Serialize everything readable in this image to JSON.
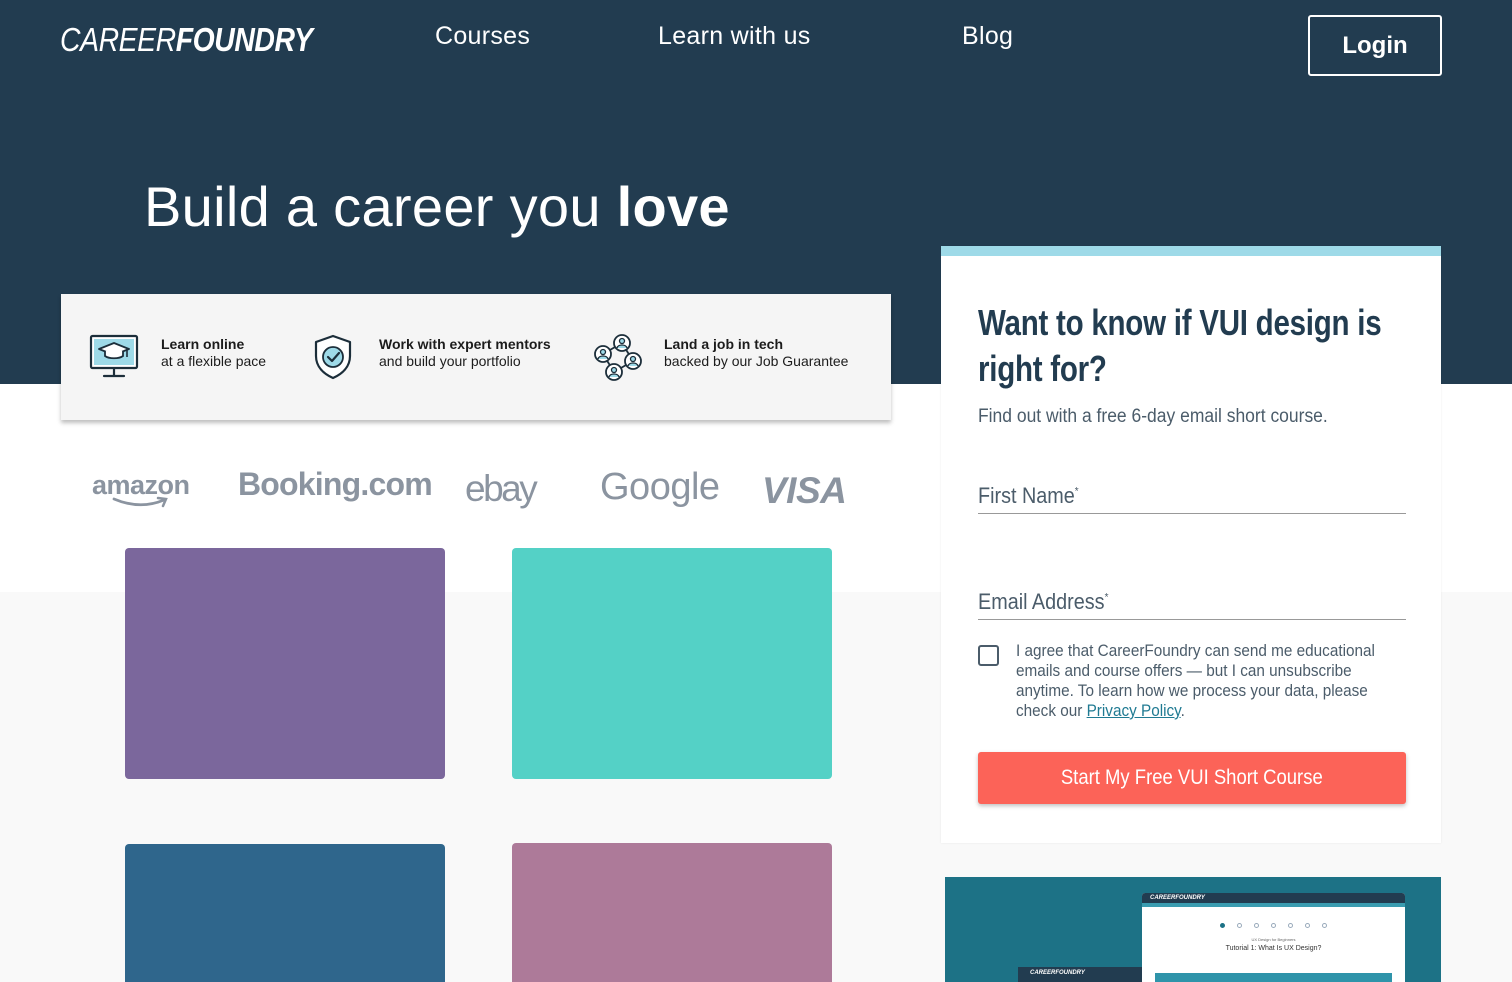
{
  "nav": {
    "logo_light": "CAREER",
    "logo_bold": "FOUNDRY",
    "links": [
      "Courses",
      "Learn with us",
      "Blog"
    ],
    "login": "Login"
  },
  "hero": {
    "title_light": "Build a career you ",
    "title_bold": "love"
  },
  "features": [
    {
      "icon": "graduation-monitor-icon",
      "title": "Learn online",
      "sub": "at a flexible pace"
    },
    {
      "icon": "shield-check-icon",
      "title": "Work with expert mentors",
      "sub": "and build your portfolio"
    },
    {
      "icon": "network-people-icon",
      "title": "Land a job in tech",
      "sub": "backed by our Job Guarantee"
    }
  ],
  "brands": [
    "amazon",
    "Booking.com",
    "ebay",
    "Google",
    "VISA"
  ],
  "cards": [
    {
      "color": "#7b679c"
    },
    {
      "color": "#54d1c6"
    },
    {
      "color": "#2f668c"
    },
    {
      "color": "#ad7a99"
    }
  ],
  "form": {
    "title": "Want to know if VUI design is right for?",
    "subtitle": "Find out with a free 6-day email short course.",
    "first_name_label": "First Name",
    "email_label": "Email Address",
    "required_mark": "*",
    "consent_text": "I agree that CareerFoundry can send me educational emails and course offers — but I can unsubscribe anytime. To learn how we process your data, please check our ",
    "privacy_link": "Privacy Policy",
    "consent_end": ".",
    "cta": "Start My Free VUI Short Course",
    "accent_color": "#fc6358"
  },
  "preview": {
    "logo": "CAREERFOUNDRY",
    "small": "UX Design for Beginners",
    "title": "Tutorial 1: What Is UX Design?"
  }
}
